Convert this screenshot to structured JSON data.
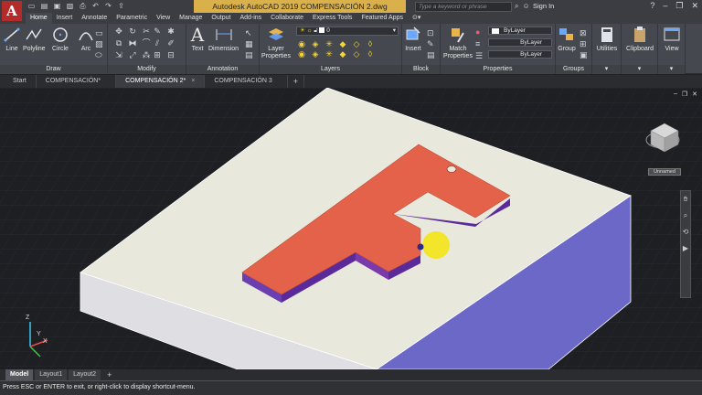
{
  "titlebar": {
    "app_logo": "A",
    "title": "Autodesk AutoCAD 2019    COMPENSACIÓN 2.dwg",
    "search_placeholder": "Type a keyword or phrase",
    "sign_in": "Sign In"
  },
  "ribbon_tabs": [
    "Home",
    "Insert",
    "Annotate",
    "Parametric",
    "View",
    "Manage",
    "Output",
    "Add-ins",
    "Collaborate",
    "Express Tools",
    "Featured Apps"
  ],
  "ribbon_tab_active": "Home",
  "draw_panel": {
    "title": "Draw",
    "line": "Line",
    "polyline": "Polyline",
    "circle": "Circle",
    "arc": "Arc"
  },
  "modify_panel": {
    "title": "Modify"
  },
  "annotation_panel": {
    "title": "Annotation",
    "text": "Text",
    "dimension": "Dimension"
  },
  "layers_panel": {
    "title": "Layers",
    "layer_properties": "Layer Properties",
    "current_layer": "0"
  },
  "block_panel": {
    "title": "Block",
    "insert": "Insert"
  },
  "properties_panel": {
    "title": "Properties",
    "match_properties": "Match Properties",
    "color": "ByLayer",
    "linetype": "ByLayer",
    "lineweight": "ByLayer"
  },
  "groups_panel": {
    "title": "Groups",
    "group": "Group"
  },
  "utilities": {
    "label": "Utilities"
  },
  "clipboard": {
    "label": "Clipboard"
  },
  "view_panel": {
    "label": "View"
  },
  "file_tabs": [
    "Start",
    "COMPENSACIÓN*",
    "COMPENSACIÓN 2*",
    "COMPENSACIÓN 3"
  ],
  "file_tab_active": "COMPENSACIÓN 2*",
  "viewcube": {
    "named_view": "Unnamed"
  },
  "ucs": {
    "x": "X",
    "y": "Y",
    "z": "Z"
  },
  "layout_tabs": [
    "Model",
    "Layout1",
    "Layout2"
  ],
  "layout_tab_active": "Model",
  "command_line": "Press ESC or ENTER to exit, or right-click to display shortcut-menu.",
  "colors": {
    "base_top": "#e9e8dc",
    "base_left": "#dedee3",
    "base_right": "#6b68c8",
    "f_top": "#e4624a",
    "f_side": "#5a2a9a",
    "cursor": "#f3e529",
    "accent_title": "#d9b04a"
  }
}
